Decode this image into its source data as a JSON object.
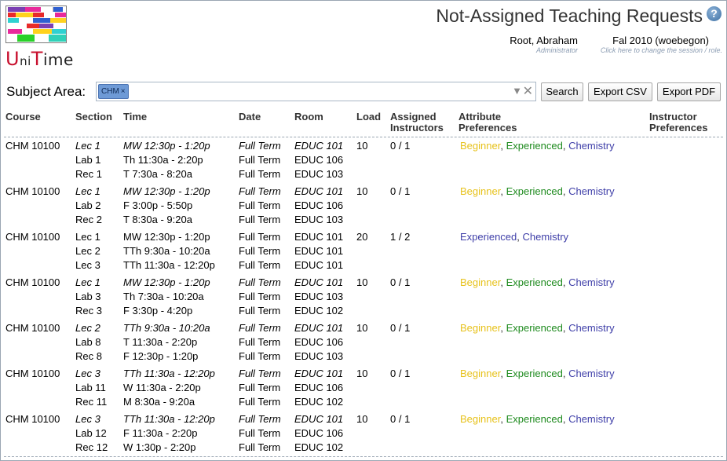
{
  "app": {
    "logo_letters": [
      "U",
      "n",
      "i",
      "T",
      "ime"
    ],
    "page_title": "Not-Assigned Teaching Requests"
  },
  "user": {
    "name": "Root, Abraham",
    "role": "Administrator"
  },
  "session": {
    "name": "Fal 2010 (woebegon)",
    "hint": "Click here to change the session / role."
  },
  "filter": {
    "label": "Subject Area:",
    "chip": "CHM",
    "chip_remove": "×",
    "search_label": "Search",
    "export_csv_label": "Export CSV",
    "export_pdf_label": "Export PDF"
  },
  "columns": {
    "course": "Course",
    "section": "Section",
    "time": "Time",
    "date": "Date",
    "room": "Room",
    "load": "Load",
    "assigned_1": "Assigned",
    "assigned_2": "Instructors",
    "attr_1": "Attribute",
    "attr_2": "Preferences",
    "instr_1": "Instructor",
    "instr_2": "Preferences"
  },
  "requests": [
    {
      "course": "CHM 10100",
      "load": "10",
      "assigned": "0 / 1",
      "attributes": [
        "Beginner",
        "Experienced",
        "Chemistry"
      ],
      "sections": [
        {
          "section": "Lec 1",
          "time": "MW 12:30p - 1:20p",
          "date": "Full Term",
          "room": "EDUC 101",
          "italic": true
        },
        {
          "section": "Lab 1",
          "time": "Th 11:30a - 2:20p",
          "date": "Full Term",
          "room": "EDUC 106",
          "italic": false
        },
        {
          "section": "Rec 1",
          "time": "T 7:30a - 8:20a",
          "date": "Full Term",
          "room": "EDUC 103",
          "italic": false
        }
      ]
    },
    {
      "course": "CHM 10100",
      "load": "10",
      "assigned": "0 / 1",
      "attributes": [
        "Beginner",
        "Experienced",
        "Chemistry"
      ],
      "sections": [
        {
          "section": "Lec 1",
          "time": "MW 12:30p - 1:20p",
          "date": "Full Term",
          "room": "EDUC 101",
          "italic": true
        },
        {
          "section": "Lab 2",
          "time": "F 3:00p - 5:50p",
          "date": "Full Term",
          "room": "EDUC 106",
          "italic": false
        },
        {
          "section": "Rec 2",
          "time": "T 8:30a - 9:20a",
          "date": "Full Term",
          "room": "EDUC 103",
          "italic": false
        }
      ]
    },
    {
      "course": "CHM 10100",
      "load": "20",
      "assigned": "1 / 2",
      "attributes": [
        "Experienced",
        "Chemistry"
      ],
      "attr_all_blue": true,
      "sections": [
        {
          "section": "Lec 1",
          "time": "MW 12:30p - 1:20p",
          "date": "Full Term",
          "room": "EDUC 101",
          "italic": false
        },
        {
          "section": "Lec 2",
          "time": "TTh 9:30a - 10:20a",
          "date": "Full Term",
          "room": "EDUC 101",
          "italic": false
        },
        {
          "section": "Lec 3",
          "time": "TTh 11:30a - 12:20p",
          "date": "Full Term",
          "room": "EDUC 101",
          "italic": false
        }
      ]
    },
    {
      "course": "CHM 10100",
      "load": "10",
      "assigned": "0 / 1",
      "attributes": [
        "Beginner",
        "Experienced",
        "Chemistry"
      ],
      "sections": [
        {
          "section": "Lec 1",
          "time": "MW 12:30p - 1:20p",
          "date": "Full Term",
          "room": "EDUC 101",
          "italic": true
        },
        {
          "section": "Lab 3",
          "time": "Th 7:30a - 10:20a",
          "date": "Full Term",
          "room": "EDUC 103",
          "italic": false
        },
        {
          "section": "Rec 3",
          "time": "F 3:30p - 4:20p",
          "date": "Full Term",
          "room": "EDUC 102",
          "italic": false
        }
      ]
    },
    {
      "course": "CHM 10100",
      "load": "10",
      "assigned": "0 / 1",
      "attributes": [
        "Beginner",
        "Experienced",
        "Chemistry"
      ],
      "sections": [
        {
          "section": "Lec 2",
          "time": "TTh 9:30a - 10:20a",
          "date": "Full Term",
          "room": "EDUC 101",
          "italic": true
        },
        {
          "section": "Lab 8",
          "time": "T 11:30a - 2:20p",
          "date": "Full Term",
          "room": "EDUC 106",
          "italic": false
        },
        {
          "section": "Rec 8",
          "time": "F 12:30p - 1:20p",
          "date": "Full Term",
          "room": "EDUC 103",
          "italic": false
        }
      ]
    },
    {
      "course": "CHM 10100",
      "load": "10",
      "assigned": "0 / 1",
      "attributes": [
        "Beginner",
        "Experienced",
        "Chemistry"
      ],
      "sections": [
        {
          "section": "Lec 3",
          "time": "TTh 11:30a - 12:20p",
          "date": "Full Term",
          "room": "EDUC 101",
          "italic": true
        },
        {
          "section": "Lab 11",
          "time": "W 11:30a - 2:20p",
          "date": "Full Term",
          "room": "EDUC 106",
          "italic": false
        },
        {
          "section": "Rec 11",
          "time": "M 8:30a - 9:20a",
          "date": "Full Term",
          "room": "EDUC 102",
          "italic": false
        }
      ]
    },
    {
      "course": "CHM 10100",
      "load": "10",
      "assigned": "0 / 1",
      "attributes": [
        "Beginner",
        "Experienced",
        "Chemistry"
      ],
      "sections": [
        {
          "section": "Lec 3",
          "time": "TTh 11:30a - 12:20p",
          "date": "Full Term",
          "room": "EDUC 101",
          "italic": true
        },
        {
          "section": "Lab 12",
          "time": "F 11:30a - 2:20p",
          "date": "Full Term",
          "room": "EDUC 106",
          "italic": false
        },
        {
          "section": "Rec 12",
          "time": "W 1:30p - 2:20p",
          "date": "Full Term",
          "room": "EDUC 102",
          "italic": false
        }
      ]
    }
  ]
}
